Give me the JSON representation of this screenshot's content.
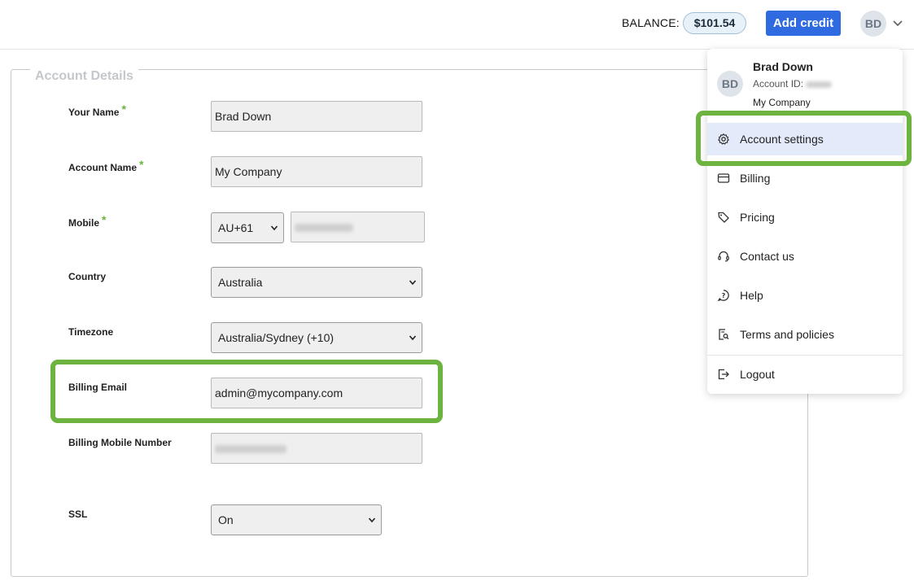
{
  "header": {
    "balance_label": "BALANCE:",
    "balance_value": "$101.54",
    "add_credit_label": "Add credit",
    "avatar_initials": "BD",
    "accent_color": "#2f6ae0"
  },
  "form": {
    "legend": "Account Details",
    "required_mark": "*",
    "your_name": {
      "label": "Your Name",
      "value": "Brad Down"
    },
    "account_name": {
      "label": "Account Name",
      "value": "My Company"
    },
    "mobile": {
      "label": "Mobile",
      "country_code": "AU+61"
    },
    "country": {
      "label": "Country",
      "value": "Australia"
    },
    "timezone": {
      "label": "Timezone",
      "value": "Australia/Sydney (+10)"
    },
    "billing_email": {
      "label": "Billing Email",
      "value": "admin@mycompany.com"
    },
    "billing_mobile": {
      "label": "Billing Mobile Number"
    },
    "ssl": {
      "label": "SSL",
      "value": "On"
    }
  },
  "menu": {
    "user_name": "Brad Down",
    "account_id_label": "Account ID:",
    "company": "My Company",
    "items": [
      {
        "label": "Account settings",
        "icon": "gear-icon",
        "active": true
      },
      {
        "label": "Billing",
        "icon": "credit-card-icon"
      },
      {
        "label": "Pricing",
        "icon": "tag-icon"
      },
      {
        "label": "Contact us",
        "icon": "headset-icon"
      },
      {
        "label": "Help",
        "icon": "help-icon"
      },
      {
        "label": "Terms and policies",
        "icon": "document-search-icon"
      },
      {
        "label": "Logout",
        "icon": "logout-icon"
      }
    ]
  },
  "highlight_color": "#6cb33f"
}
